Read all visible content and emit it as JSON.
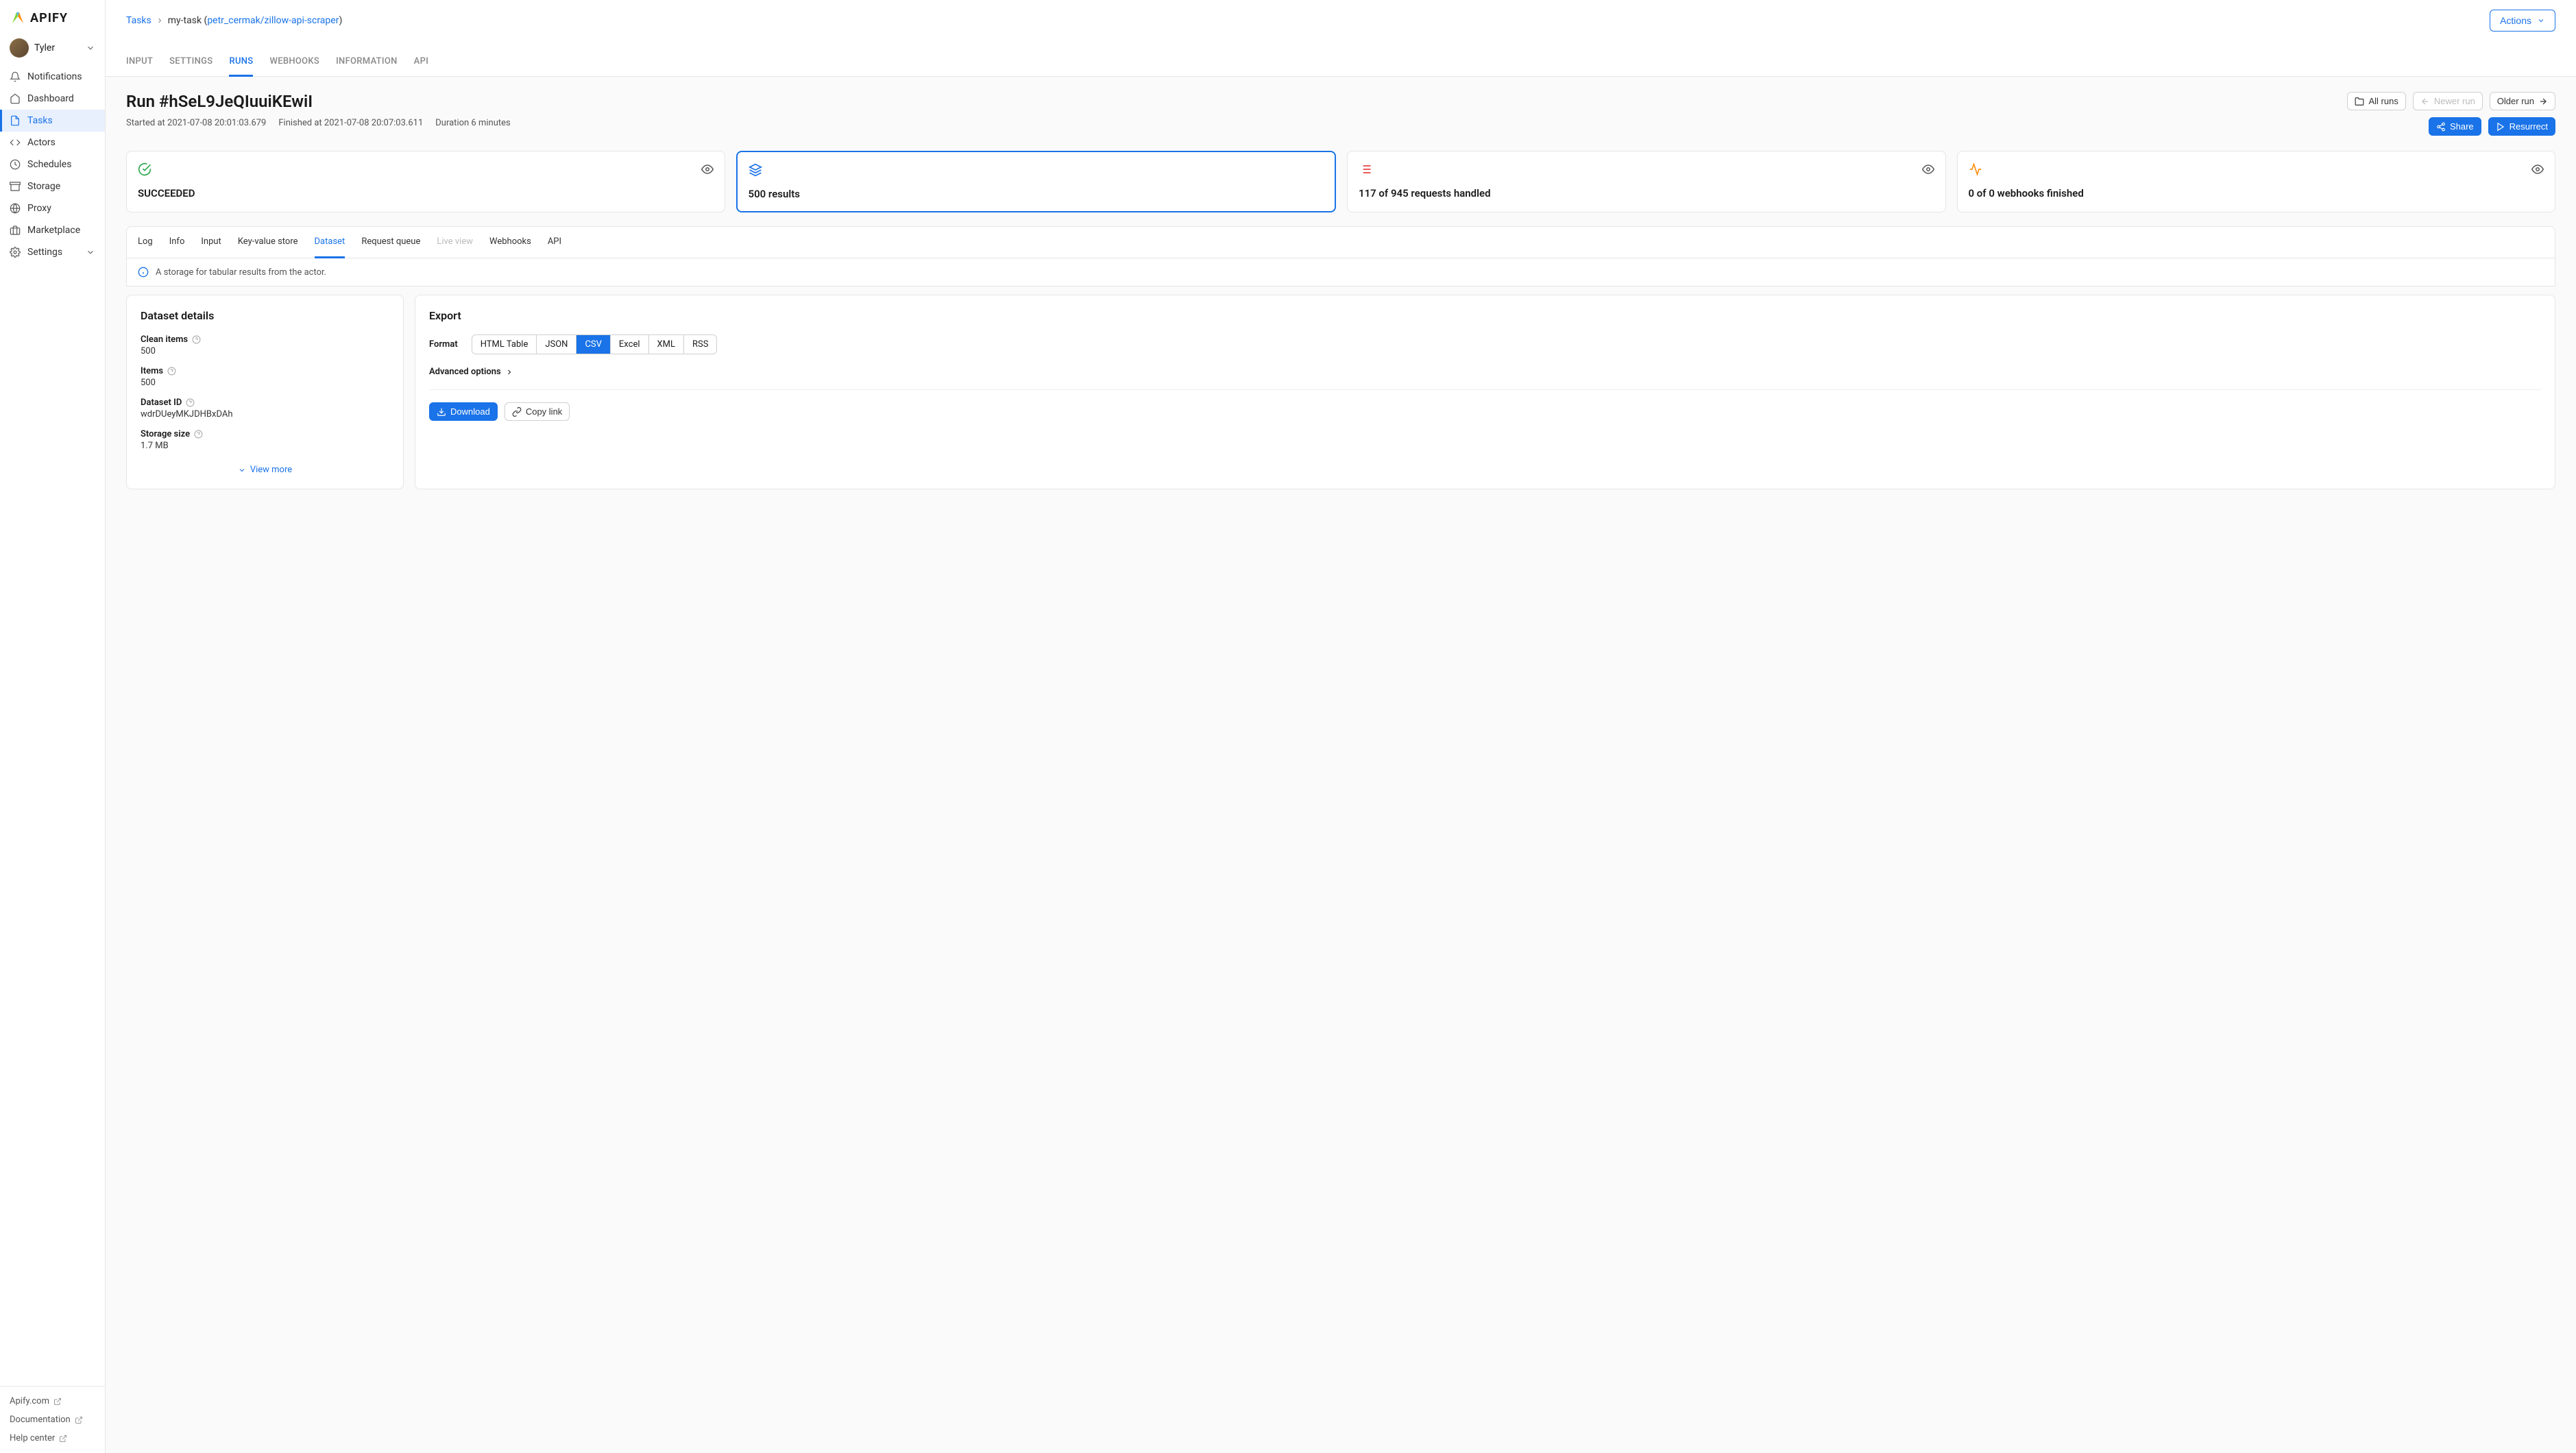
{
  "brand": "APIFY",
  "user": {
    "name": "Tyler"
  },
  "sidebar": {
    "items": [
      {
        "label": "Notifications"
      },
      {
        "label": "Dashboard"
      },
      {
        "label": "Tasks"
      },
      {
        "label": "Actors"
      },
      {
        "label": "Schedules"
      },
      {
        "label": "Storage"
      },
      {
        "label": "Proxy"
      },
      {
        "label": "Marketplace"
      },
      {
        "label": "Settings"
      }
    ],
    "footer": [
      {
        "label": "Apify.com"
      },
      {
        "label": "Documentation"
      },
      {
        "label": "Help center"
      }
    ]
  },
  "breadcrumb": {
    "root": "Tasks",
    "task_name": "my-task",
    "actor_link": "petr_cermak/zillow-api-scraper"
  },
  "actions_label": "Actions",
  "main_tabs": [
    "INPUT",
    "SETTINGS",
    "RUNS",
    "WEBHOOKS",
    "INFORMATION",
    "API"
  ],
  "run": {
    "title": "Run #hSeL9JeQIuuiKEwiI",
    "started": "Started at 2021-07-08 20:01:03.679",
    "finished": "Finished at 2021-07-08 20:07:03.611",
    "duration": "Duration 6 minutes",
    "all_runs": "All runs",
    "newer": "Newer run",
    "older": "Older run",
    "share": "Share",
    "resurrect": "Resurrect"
  },
  "cards": {
    "status": "SUCCEEDED",
    "results": "500 results",
    "requests": "117 of 945 requests handled",
    "webhooks": "0 of 0 webhooks finished"
  },
  "subtabs": [
    "Log",
    "Info",
    "Input",
    "Key-value store",
    "Dataset",
    "Request queue",
    "Live view",
    "Webhooks",
    "API"
  ],
  "info_text": "A storage for tabular results from the actor.",
  "dataset": {
    "title": "Dataset details",
    "clean_label": "Clean items",
    "clean_value": "500",
    "items_label": "Items",
    "items_value": "500",
    "id_label": "Dataset ID",
    "id_value": "wdrDUeyMKJDHBxDAh",
    "size_label": "Storage size",
    "size_value": "1.7 MB",
    "view_more": "View more"
  },
  "export": {
    "title": "Export",
    "format_label": "Format",
    "formats": [
      "HTML Table",
      "JSON",
      "CSV",
      "Excel",
      "XML",
      "RSS"
    ],
    "advanced": "Advanced options",
    "download": "Download",
    "copy_link": "Copy link"
  }
}
